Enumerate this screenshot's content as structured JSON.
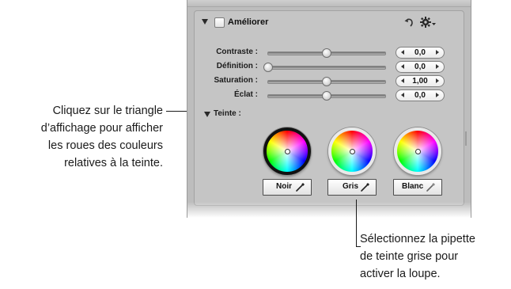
{
  "callouts": {
    "left": {
      "line1": "Cliquez sur le triangle",
      "line2": "d’affichage pour afficher",
      "line3": "les roues des couleurs",
      "line4": "relatives à la teinte."
    },
    "right": {
      "line1": "Sélectionnez la pipette",
      "line2": "de teinte grise pour",
      "line3": "activer la loupe."
    }
  },
  "panel": {
    "header": {
      "title": "Améliorer",
      "checked": false,
      "icons": [
        "disclosure-triangle-icon",
        "undo-icon",
        "gear-icon"
      ]
    },
    "sliders": [
      {
        "label": "Contraste :",
        "value": "0,0",
        "fraction": 0.5
      },
      {
        "label": "Définition :",
        "value": "0,0",
        "fraction": 0.0
      },
      {
        "label": "Saturation :",
        "value": "1,00",
        "fraction": 0.5
      },
      {
        "label": "Éclat :",
        "value": "0,0",
        "fraction": 0.5
      }
    ],
    "tint": {
      "label": "Teinte :",
      "wheels": [
        {
          "name": "noir",
          "selected": true
        },
        {
          "name": "gris",
          "selected": false
        },
        {
          "name": "blanc",
          "selected": false
        }
      ],
      "buttons": {
        "noir": "Noir",
        "gris": "Gris",
        "blanc": "Blanc"
      }
    }
  },
  "colors": {
    "panel_bg": "#bdbdbd",
    "text": "#1a1a1a"
  }
}
